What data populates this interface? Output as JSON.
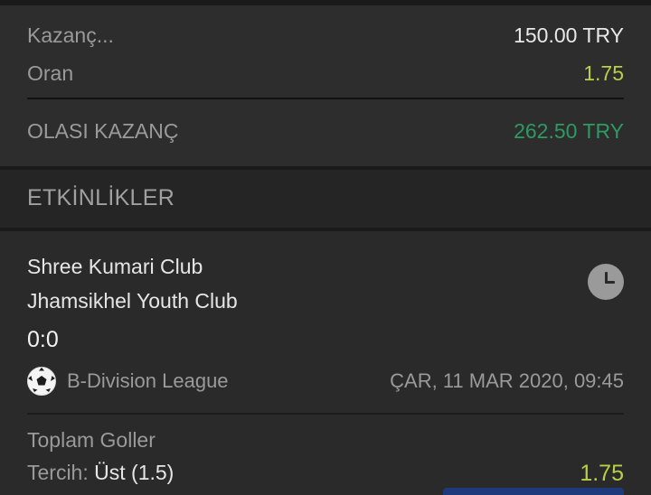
{
  "summary": {
    "stake_label": "Kazanç...",
    "stake_value": "150.00 TRY",
    "odds_label": "Oran",
    "odds_value": "1.75",
    "potential_label": "OLASI KAZANÇ",
    "potential_value": "262.50 TRY"
  },
  "events_header": "ETKİNLİKLER",
  "event": {
    "home_team": "Shree Kumari Club",
    "away_team": "Jhamsikhel Youth Club",
    "score": "0:0",
    "league": "B-Division League",
    "datetime": "ÇAR, 11 MAR 2020, 09:45",
    "market": "Toplam Goller",
    "pick_label": "Tercih:",
    "pick_value": "Üst (1.5)",
    "odd": "1.75",
    "icons": [
      "clock-icon",
      "soccer-ball-icon"
    ]
  },
  "colors": {
    "odds_green": "#b9d045",
    "potential_green": "#2e9a62",
    "background": "#2a2a2a"
  }
}
